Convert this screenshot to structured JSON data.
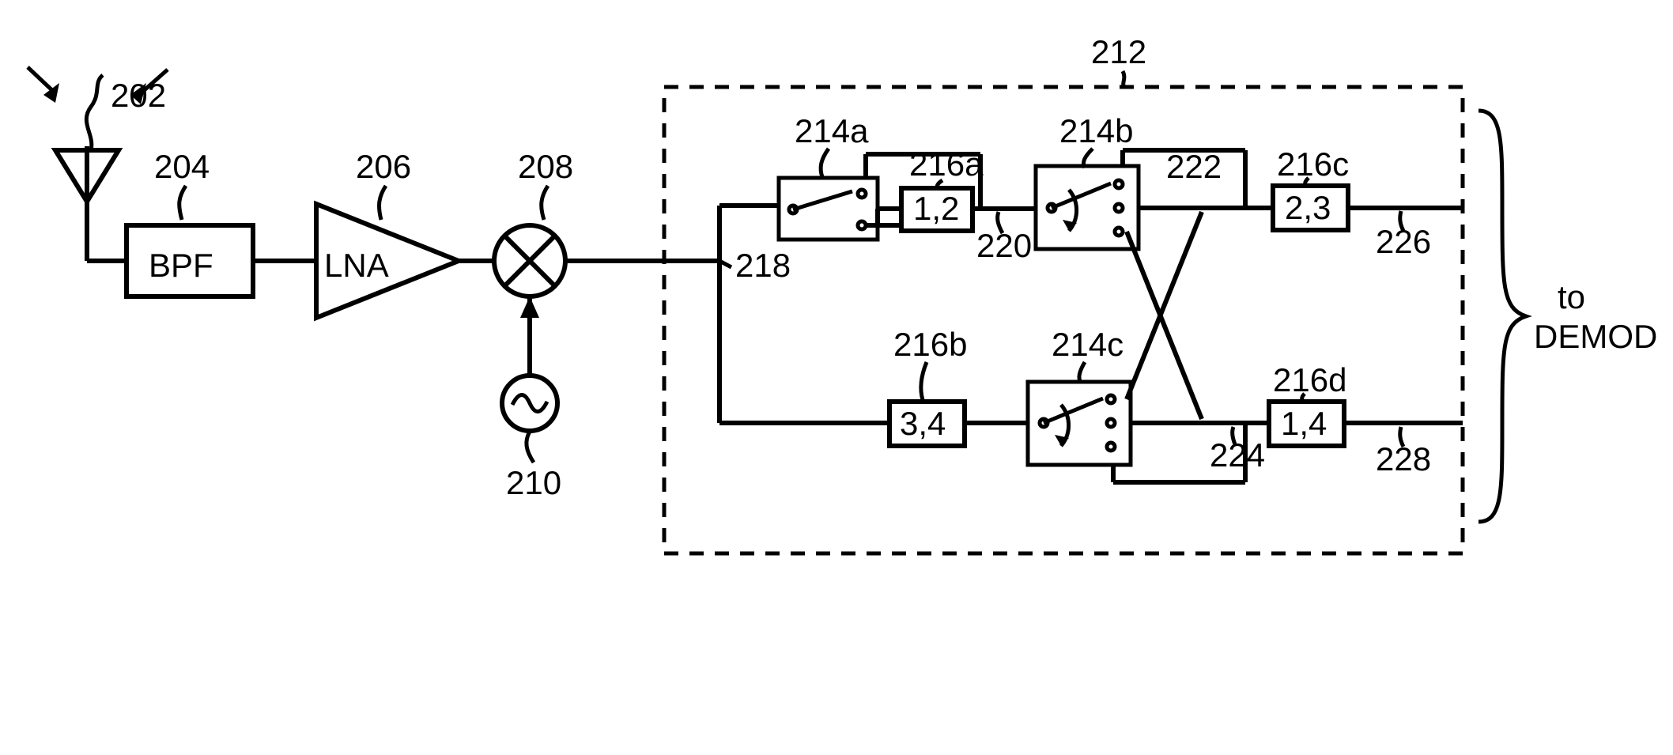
{
  "labels": {
    "l202": "202",
    "l204": "204",
    "l206": "206",
    "l208": "208",
    "l210": "210",
    "l212": "212",
    "l214a": "214a",
    "l214b": "214b",
    "l214c": "214c",
    "l216a": "216a",
    "l216b": "216b",
    "l216c": "216c",
    "l216d": "216d",
    "l218": "218",
    "l220": "220",
    "l222": "222",
    "l224": "224",
    "l226": "226",
    "l228": "228"
  },
  "blocks": {
    "bpf": "BPF",
    "lna": "LNA",
    "f216a": "1,2",
    "f216b": "3,4",
    "f216c": "2,3",
    "f216d": "1,4",
    "demod_to": "to",
    "demod": "DEMOD"
  }
}
